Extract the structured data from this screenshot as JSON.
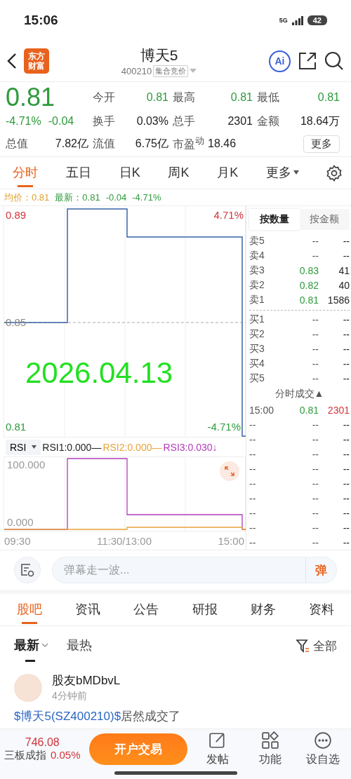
{
  "status_bar": {
    "time": "15:06",
    "network": "5G",
    "battery": "42"
  },
  "header": {
    "logo": [
      "东方",
      "财富"
    ],
    "title": "博天5",
    "code": "400210",
    "tag": "集合竞价",
    "ai": "Ai"
  },
  "quote": {
    "price": "0.81",
    "change_pct": "-4.71%",
    "change": "-0.04",
    "stats": [
      {
        "label": "今开",
        "value": "0.81",
        "kind": "price"
      },
      {
        "label": "最高",
        "value": "0.81",
        "kind": "price"
      },
      {
        "label": "最低",
        "value": "0.81",
        "kind": "price"
      },
      {
        "label": "换手",
        "value": "0.03%",
        "kind": "plain"
      },
      {
        "label": "总手",
        "value": "2301",
        "kind": "plain"
      },
      {
        "label": "金额",
        "value": "18.64万",
        "kind": "plain"
      },
      {
        "label": "总值",
        "value": "7.82亿",
        "kind": "plain"
      },
      {
        "label": "流值",
        "value": "6.75亿",
        "kind": "plain"
      },
      {
        "label": "市盈$^{动}$",
        "value": "18.46",
        "kind": "info"
      }
    ],
    "more_button": "更多"
  },
  "chart_tabs": [
    {
      "label": "分时",
      "selected": true,
      "kind": "tab"
    },
    {
      "label": "五日",
      "selected": false,
      "kind": "tab"
    },
    {
      "label": "日K",
      "selected": false,
      "kind": "tab"
    },
    {
      "label": "周K",
      "selected": false,
      "kind": "tab"
    },
    {
      "label": "月K",
      "selected": false,
      "kind": "tab"
    },
    {
      "label": "更多",
      "selected": false,
      "kind": "menu"
    }
  ],
  "info_line": {
    "average": "均价：0.81",
    "latest": "最新：0.81",
    "change": "-0.04",
    "change_pct": "-4.71%"
  },
  "price_chart": {
    "date_stamp": "2026.04.13",
    "top_pct": "4.71%",
    "bottom_pct": "-4.71%",
    "y_labels": [
      "0.89",
      "0.85",
      "0.81"
    ]
  },
  "rsi": {
    "selector": "RSI",
    "legend": [
      {
        "text": "RSI1:0.000—",
        "color": "#222222"
      },
      {
        "text": "RSI2:0.000—",
        "color": "#e8a33a"
      },
      {
        "text": "RSI3:0.030↓",
        "color": "#b03cb8"
      }
    ],
    "y_labels": [
      "100.000",
      "0.000"
    ],
    "time_labels": [
      "09:30",
      "11:30/13:00",
      "15:00"
    ]
  },
  "order_book": {
    "tabs": [
      {
        "label": "按数量",
        "selected": true
      },
      {
        "label": "按金额",
        "selected": false
      }
    ],
    "asks": [
      {
        "label": "卖5",
        "price": "--",
        "volume": "--"
      },
      {
        "label": "卖4",
        "price": "--",
        "volume": "--"
      },
      {
        "label": "卖3",
        "price": "0.83",
        "volume": "41"
      },
      {
        "label": "卖2",
        "price": "0.82",
        "volume": "40"
      },
      {
        "label": "卖1",
        "price": "0.81",
        "volume": "1586"
      }
    ],
    "bids": [
      {
        "label": "买1",
        "price": "--",
        "volume": "--"
      },
      {
        "label": "买2",
        "price": "--",
        "volume": "--"
      },
      {
        "label": "买3",
        "price": "--",
        "volume": "--"
      },
      {
        "label": "买4",
        "price": "--",
        "volume": "--"
      },
      {
        "label": "买5",
        "price": "--",
        "volume": "--"
      }
    ],
    "trades_title": "分时成交▲",
    "trades": [
      {
        "time": "15:00",
        "price": "0.81",
        "volume": "2301"
      },
      {
        "time": "--",
        "price": "--",
        "volume": "--"
      },
      {
        "time": "--",
        "price": "--",
        "volume": "--"
      },
      {
        "time": "--",
        "price": "--",
        "volume": "--"
      },
      {
        "time": "--",
        "price": "--",
        "volume": "--"
      },
      {
        "time": "--",
        "price": "--",
        "volume": "--"
      },
      {
        "time": "--",
        "price": "--",
        "volume": "--"
      },
      {
        "time": "--",
        "price": "--",
        "volume": "--"
      },
      {
        "time": "--",
        "price": "--",
        "volume": "--"
      },
      {
        "time": "--",
        "price": "--",
        "volume": "--"
      }
    ]
  },
  "comment_bar": {
    "placeholder": "弹幕走一波...",
    "send": "弹"
  },
  "content_tabs": [
    {
      "label": "股吧",
      "selected": true
    },
    {
      "label": "资讯",
      "selected": false
    },
    {
      "label": "公告",
      "selected": false
    },
    {
      "label": "研报",
      "selected": false
    },
    {
      "label": "财务",
      "selected": false
    },
    {
      "label": "资料",
      "selected": false
    }
  ],
  "sort_tabs": [
    {
      "label": "最新",
      "selected": true
    },
    {
      "label": "最热",
      "selected": false
    }
  ],
  "filter": "全部",
  "post": {
    "user": "股友bMDbvL",
    "time": "4分钟前",
    "stock_link": "$博天5(SZ400210)$",
    "text": "居然成交了"
  },
  "bottom_bar": {
    "index_value": "746.08",
    "index_name": "三板成指",
    "index_change": "0.05%",
    "trade_button": "开户交易",
    "actions": [
      {
        "label": "发帖",
        "kind": "post"
      },
      {
        "label": "功能",
        "kind": "grid"
      },
      {
        "label": "设自选",
        "kind": "more"
      }
    ]
  }
}
